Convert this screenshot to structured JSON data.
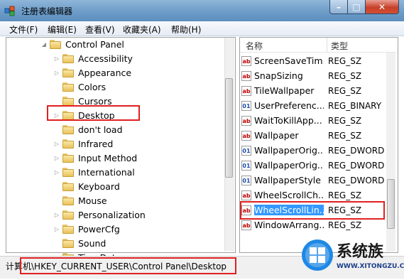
{
  "window": {
    "title": "注册表编辑器"
  },
  "title_buttons": {
    "minimize": "–",
    "maximize": "□",
    "close": "✕"
  },
  "menu": [
    "文件(F)",
    "编辑(E)",
    "查看(V)",
    "收藏夹(A)",
    "帮助(H)"
  ],
  "tree": {
    "root": "Control Panel",
    "items": [
      {
        "label": "Accessibility",
        "expandable": true
      },
      {
        "label": "Appearance",
        "expandable": true
      },
      {
        "label": "Colors",
        "expandable": false
      },
      {
        "label": "Cursors",
        "expandable": false
      },
      {
        "label": "Desktop",
        "expandable": true,
        "selected": true
      },
      {
        "label": "don't load",
        "expandable": false
      },
      {
        "label": "Infrared",
        "expandable": true
      },
      {
        "label": "Input Method",
        "expandable": true
      },
      {
        "label": "International",
        "expandable": true
      },
      {
        "label": "Keyboard",
        "expandable": false
      },
      {
        "label": "Mouse",
        "expandable": false
      },
      {
        "label": "Personalization",
        "expandable": true
      },
      {
        "label": "PowerCfg",
        "expandable": true
      },
      {
        "label": "Sound",
        "expandable": false
      },
      {
        "label": "TimeDate",
        "expandable": false
      }
    ]
  },
  "list": {
    "headers": {
      "name": "名称",
      "type": "类型"
    },
    "rows": [
      {
        "name": "ScreenSaveTim...",
        "type": "REG_SZ",
        "icon": "ab"
      },
      {
        "name": "SnapSizing",
        "type": "REG_SZ",
        "icon": "ab"
      },
      {
        "name": "TileWallpaper",
        "type": "REG_SZ",
        "icon": "ab"
      },
      {
        "name": "UserPreferenc...",
        "type": "REG_BINARY",
        "icon": "bin"
      },
      {
        "name": "WaitToKillApp...",
        "type": "REG_SZ",
        "icon": "ab"
      },
      {
        "name": "Wallpaper",
        "type": "REG_SZ",
        "icon": "ab"
      },
      {
        "name": "WallpaperOrig...",
        "type": "REG_DWORD",
        "icon": "bin"
      },
      {
        "name": "WallpaperOrig...",
        "type": "REG_DWORD",
        "icon": "bin"
      },
      {
        "name": "WallpaperStyle",
        "type": "REG_DWORD",
        "icon": "bin"
      },
      {
        "name": "WheelScrollCh...",
        "type": "REG_SZ",
        "icon": "ab"
      },
      {
        "name": "WheelScrollLin...",
        "type": "REG_SZ",
        "icon": "ab",
        "selected": true
      },
      {
        "name": "WindowArrang...",
        "type": "REG_SZ",
        "icon": "ab"
      }
    ]
  },
  "status": {
    "path": "计算机\\HKEY_CURRENT_USER\\Control Panel\\Desktop"
  },
  "watermark": {
    "title": "系统族",
    "url": "WWW.XITONGZU.COM"
  }
}
